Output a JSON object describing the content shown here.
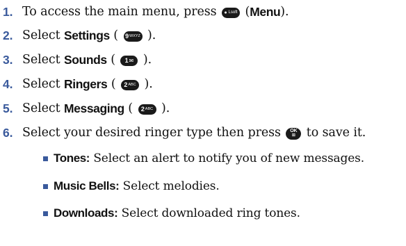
{
  "steps": [
    {
      "num": "1.",
      "pre": "To access the main menu, press ",
      "key": "•Lsoft",
      "paren_open": " (",
      "kw": "Menu",
      "post": ")."
    },
    {
      "num": "2.",
      "pre": "Select ",
      "kw": "Settings",
      "mid": " ( ",
      "key": "9WXYZ",
      "post": " )."
    },
    {
      "num": "3.",
      "pre": "Select ",
      "kw": "Sounds",
      "mid": " ( ",
      "key": "1 ✉",
      "post": " )."
    },
    {
      "num": "4.",
      "pre": "Select ",
      "kw": "Ringers",
      "mid": " ( ",
      "key": "2ABC",
      "post": " )."
    },
    {
      "num": "5.",
      "pre": "Select ",
      "kw": "Messaging",
      "mid": " ( ",
      "key": "2ABC",
      "post": " )."
    },
    {
      "num": "6.",
      "pre": "Select your desired ringer type then press ",
      "key": "OK",
      "post": " to save it."
    }
  ],
  "subitems": [
    {
      "kw": "Tones:",
      "text": " Select an alert to notify you of new messages."
    },
    {
      "kw": "Music Bells:",
      "text": " Select melodies."
    },
    {
      "kw": "Downloads:",
      "text": " Select downloaded ring tones."
    }
  ],
  "colors": {
    "accent": "#3a5a9c",
    "key_bg": "#1a1a1a",
    "text": "#111111"
  },
  "icons": {
    "menu_key": "left-softkey-icon",
    "ok_key": "ok-key-icon"
  }
}
